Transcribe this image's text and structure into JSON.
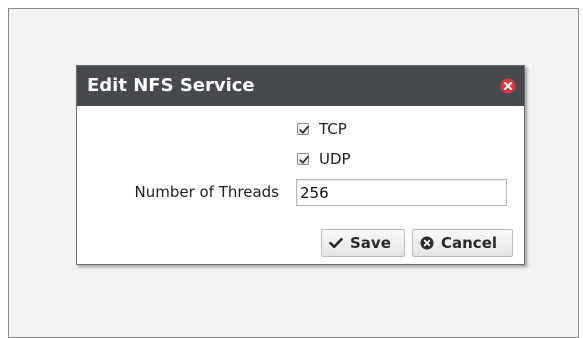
{
  "dialog": {
    "title": "Edit NFS Service",
    "close_icon": "close-icon",
    "tcp": {
      "label": "TCP",
      "checked": true
    },
    "udp": {
      "label": "UDP",
      "checked": true
    },
    "threads": {
      "label": "Number of Threads",
      "value": "256"
    },
    "save_label": "Save",
    "save_icon": "checkmark-icon",
    "cancel_label": "Cancel",
    "cancel_icon": "cancel-circle-icon"
  },
  "colors": {
    "titlebar": "#46494d",
    "close_icon": "#e8323b",
    "frame_border": "#8a8a8a"
  }
}
